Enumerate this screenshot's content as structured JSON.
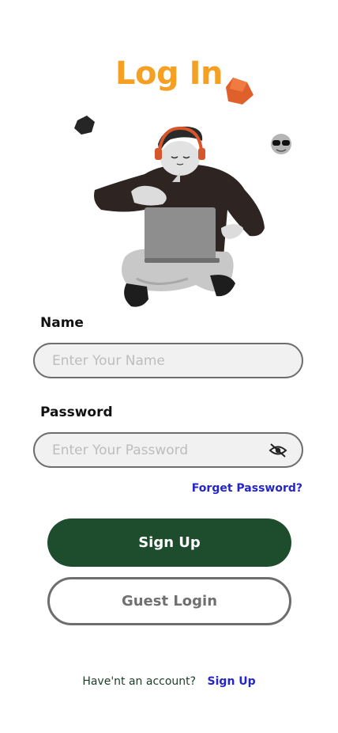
{
  "login": {
    "title": "Log In",
    "title_color": "#f5a023",
    "name": {
      "label": "Name",
      "placeholder": "Enter Your Name",
      "value": ""
    },
    "password": {
      "label": "Password",
      "placeholder": "Enter Your Password",
      "value": "",
      "toggle_icon": "eye-off-icon"
    },
    "forgot_password": "Forget Password?",
    "sign_up_button": "Sign Up",
    "guest_login_button": "Guest Login",
    "footer": {
      "question": "Have'nt an account?",
      "link": "Sign Up"
    }
  },
  "colors": {
    "accent": "#f5a023",
    "primary_button": "#1e4d2e",
    "link": "#2525c9"
  }
}
